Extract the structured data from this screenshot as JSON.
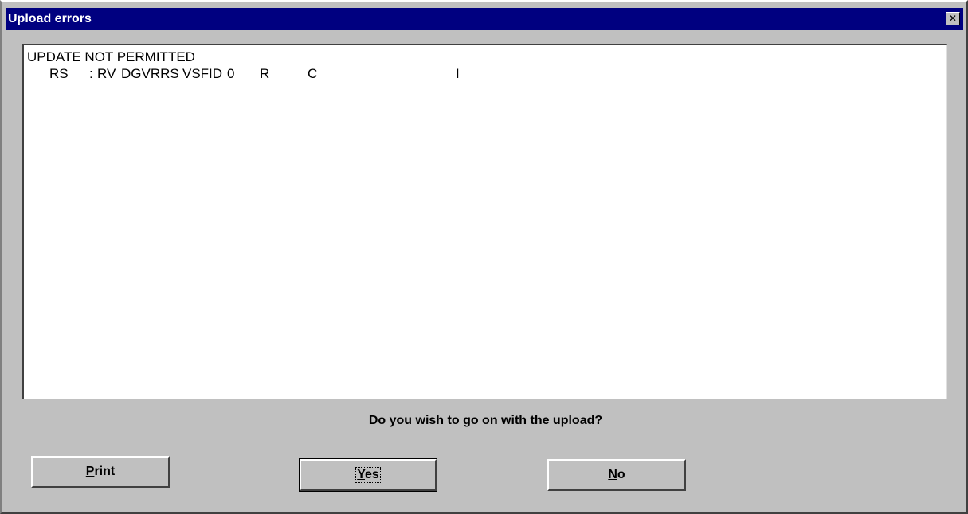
{
  "window": {
    "title": "Upload errors",
    "close_glyph": "✕"
  },
  "errors": {
    "heading": "UPDATE NOT PERMITTED",
    "detail_tokens": [
      "RS",
      ":",
      "RV",
      "DGVRRS",
      "VSFID",
      "0",
      "R",
      "C",
      "I"
    ]
  },
  "prompt": {
    "question": "Do you wish to go on with the upload?"
  },
  "buttons": {
    "print": {
      "mnemonic": "P",
      "rest": "rint"
    },
    "yes": {
      "mnemonic": "Y",
      "rest": "es",
      "default": true
    },
    "no": {
      "mnemonic": "N",
      "rest": "o"
    }
  }
}
